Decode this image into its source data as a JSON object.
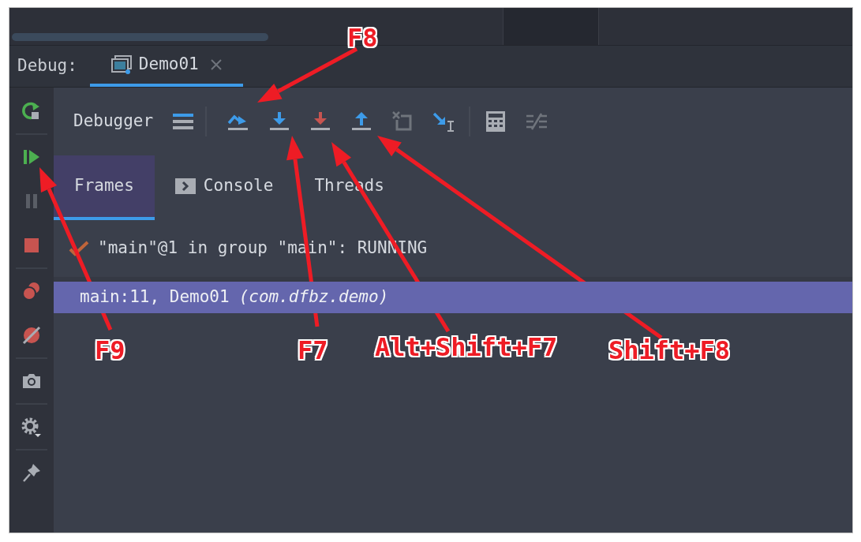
{
  "panel": {
    "label": "Debug:",
    "tabs": [
      {
        "label": "Demo01",
        "selected": true
      }
    ]
  },
  "toolbar": {
    "title": "Debugger"
  },
  "subtabs": [
    {
      "label": "Frames",
      "selected": true,
      "kind": "plain"
    },
    {
      "label": "Console",
      "selected": false,
      "kind": "console"
    },
    {
      "label": "Threads",
      "selected": false,
      "kind": "plain"
    }
  ],
  "thread": {
    "text": "\"main\"@1 in group \"main\": RUNNING"
  },
  "frames": [
    {
      "text": "main:11, Demo01",
      "detail": "(com.dfbz.demo)",
      "selected": true
    }
  ],
  "annotations": [
    {
      "label": "F8"
    },
    {
      "label": "F9"
    },
    {
      "label": "F7"
    },
    {
      "label": "Alt+Shift+F7"
    },
    {
      "label": "Shift+F8"
    }
  ]
}
